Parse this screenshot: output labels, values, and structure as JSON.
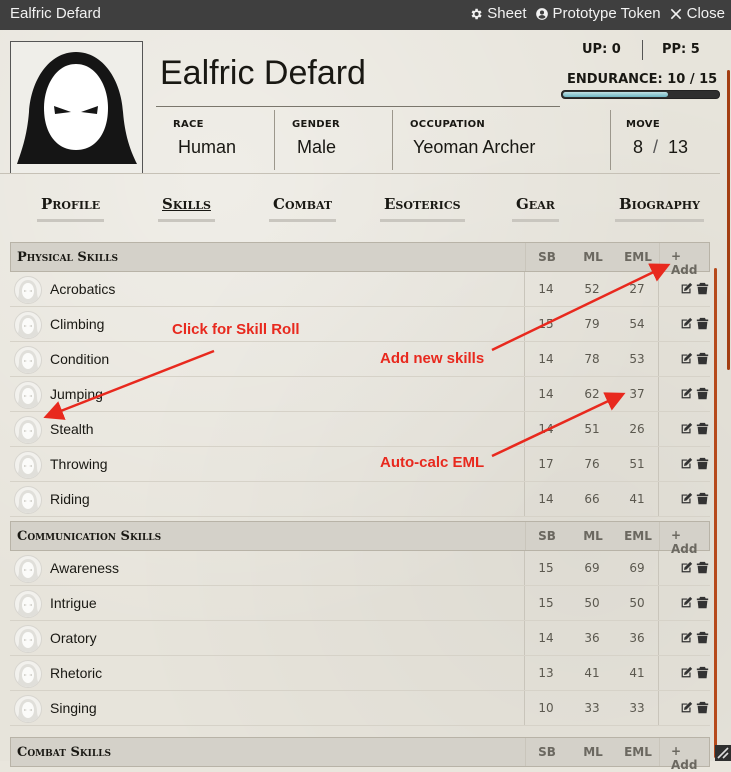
{
  "window": {
    "title": "Ealfric Defard",
    "controls": [
      {
        "label": "Sheet",
        "icon": "gear-icon"
      },
      {
        "label": "Prototype Token",
        "icon": "user-circle-icon"
      },
      {
        "label": "Close",
        "icon": "close-icon"
      }
    ]
  },
  "character": {
    "name": "Ealfric Defard",
    "up": "UP: 0",
    "pp": "PP: 5",
    "endurance": "ENDURANCE: 10 / 15",
    "endurance_fraction": 0.67,
    "race_label": "RACE",
    "race": "Human",
    "gender_label": "GENDER",
    "gender": "Male",
    "occupation_label": "OCCUPATION",
    "occupation": "Yeoman Archer",
    "move_label": "MOVE",
    "move_current": "8",
    "move_max": "13",
    "portrait_icon": "hooded-figure-icon"
  },
  "tabs": [
    "Profile",
    "Skills",
    "Combat",
    "Esoterics",
    "Gear",
    "Biography"
  ],
  "active_tab": "Skills",
  "columns": {
    "sb": "SB",
    "ml": "ML",
    "eml": "EML",
    "add": "Add"
  },
  "sections": [
    {
      "title": "Physical Skills",
      "skills": [
        {
          "name": "Acrobatics",
          "sb": "14",
          "ml": "52",
          "eml": "27"
        },
        {
          "name": "Climbing",
          "sb": "15",
          "ml": "79",
          "eml": "54"
        },
        {
          "name": "Condition",
          "sb": "14",
          "ml": "78",
          "eml": "53"
        },
        {
          "name": "Jumping",
          "sb": "14",
          "ml": "62",
          "eml": "37"
        },
        {
          "name": "Stealth",
          "sb": "14",
          "ml": "51",
          "eml": "26"
        },
        {
          "name": "Throwing",
          "sb": "17",
          "ml": "76",
          "eml": "51"
        },
        {
          "name": "Riding",
          "sb": "14",
          "ml": "66",
          "eml": "41"
        }
      ]
    },
    {
      "title": "Communication Skills",
      "skills": [
        {
          "name": "Awareness",
          "sb": "15",
          "ml": "69",
          "eml": "69"
        },
        {
          "name": "Intrigue",
          "sb": "15",
          "ml": "50",
          "eml": "50"
        },
        {
          "name": "Oratory",
          "sb": "14",
          "ml": "36",
          "eml": "36"
        },
        {
          "name": "Rhetoric",
          "sb": "13",
          "ml": "41",
          "eml": "41"
        },
        {
          "name": "Singing",
          "sb": "10",
          "ml": "33",
          "eml": "33"
        }
      ]
    },
    {
      "title": "Combat Skills",
      "skills": []
    }
  ],
  "annotations": {
    "skill_roll": "Click for Skill Roll",
    "add_skills": "Add new skills",
    "auto_calc": "Auto-calc EML"
  },
  "colors": {
    "annotation": "#e8291e",
    "accent": "#b64a1c",
    "endurance_fill": "#6fb7c4"
  }
}
